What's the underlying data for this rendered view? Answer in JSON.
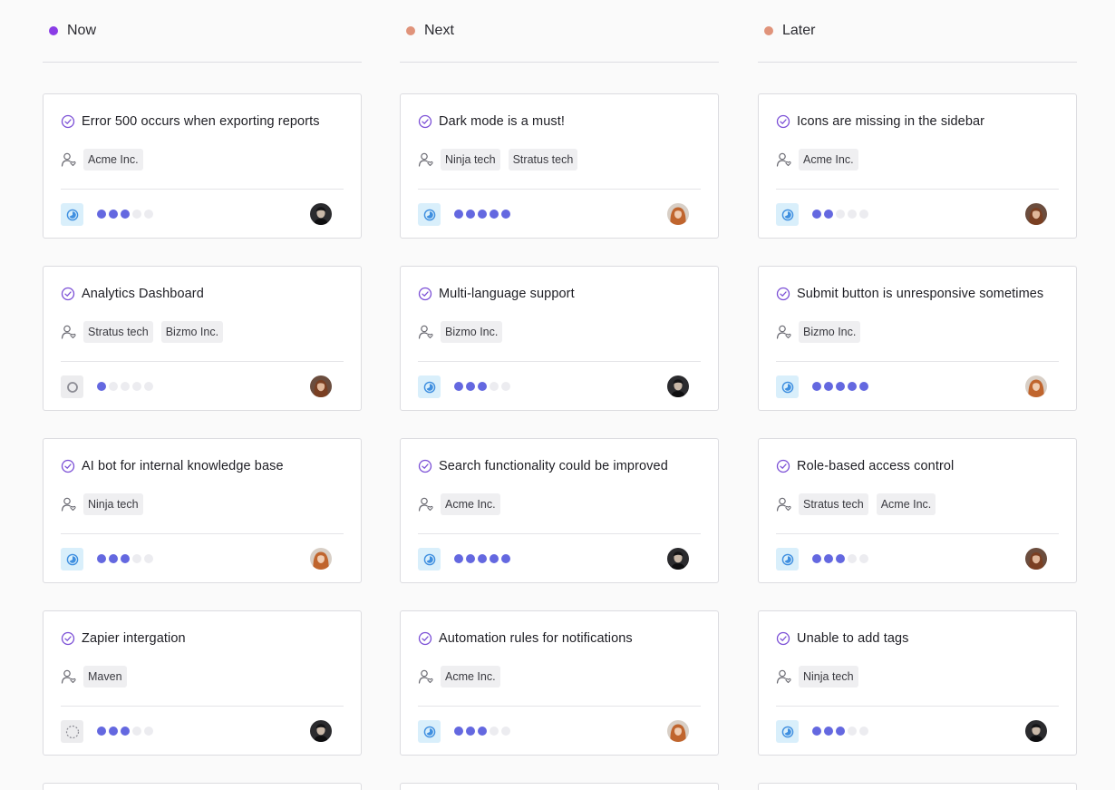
{
  "columns": [
    {
      "title": "Now",
      "dot_color": "#8a3ce6",
      "cards": [
        {
          "title": "Error 500 occurs when exporting reports",
          "tags": [
            "Acme Inc."
          ],
          "status": "inprogress",
          "priority": 3,
          "avatar": "dark"
        },
        {
          "title": "Analytics Dashboard",
          "tags": [
            "Stratus tech",
            "Bizmo Inc."
          ],
          "status": "todo",
          "priority": 1,
          "avatar": "auburn"
        },
        {
          "title": "AI bot for internal knowledge base",
          "tags": [
            "Ninja tech"
          ],
          "status": "inprogress",
          "priority": 3,
          "avatar": "ginger"
        },
        {
          "title": "Zapier intergation",
          "tags": [
            "Maven"
          ],
          "status": "backlog",
          "priority": 3,
          "avatar": "dark"
        }
      ]
    },
    {
      "title": "Next",
      "dot_color": "#e0937a",
      "cards": [
        {
          "title": "Dark mode is a must!",
          "tags": [
            "Ninja tech",
            "Stratus tech"
          ],
          "status": "inprogress",
          "priority": 5,
          "avatar": "ginger"
        },
        {
          "title": "Multi-language support",
          "tags": [
            "Bizmo Inc."
          ],
          "status": "inprogress",
          "priority": 3,
          "avatar": "dark"
        },
        {
          "title": "Search functionality could be improved",
          "tags": [
            "Acme Inc."
          ],
          "status": "inprogress",
          "priority": 5,
          "avatar": "dark"
        },
        {
          "title": "Automation rules for notifications",
          "tags": [
            "Acme Inc."
          ],
          "status": "inprogress",
          "priority": 3,
          "avatar": "ginger"
        }
      ]
    },
    {
      "title": "Later",
      "dot_color": "#e0937a",
      "cards": [
        {
          "title": "Icons are missing in the sidebar",
          "tags": [
            "Acme Inc."
          ],
          "status": "inprogress",
          "priority": 2,
          "avatar": "auburn"
        },
        {
          "title": "Submit button is unresponsive sometimes",
          "tags": [
            "Bizmo Inc."
          ],
          "status": "inprogress",
          "priority": 5,
          "avatar": "ginger"
        },
        {
          "title": "Role-based access control",
          "tags": [
            "Stratus tech",
            "Acme Inc."
          ],
          "status": "inprogress",
          "priority": 3,
          "avatar": "auburn"
        },
        {
          "title": "Unable to add tags",
          "tags": [
            "Ninja tech"
          ],
          "status": "inprogress",
          "priority": 3,
          "avatar": "dark"
        }
      ]
    }
  ],
  "priority_max": 5,
  "colors": {
    "accent": "#6468e0",
    "check": "#7b4fd6",
    "status_inprogress": "#3f8fe0",
    "status_bg": "#d9effb"
  },
  "icons": {
    "title": "check-circle-icon",
    "customer": "user-heart-icon",
    "status": "status-icon"
  }
}
